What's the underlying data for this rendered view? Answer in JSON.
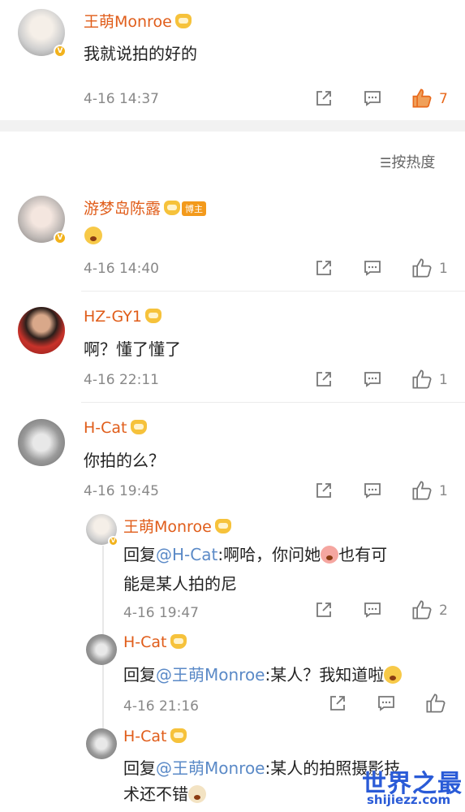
{
  "top_comment": {
    "user": "王萌Monroe",
    "text": "我就说拍的好的",
    "time": "4-16 14:37",
    "likes": "7"
  },
  "sort": {
    "label": "按热度",
    "icon": "sort-icon"
  },
  "comments": [
    {
      "user": "游梦岛陈露",
      "tag": "博主",
      "time": "4-16 14:40",
      "likes": "1"
    },
    {
      "user": "HZ-GY1",
      "text": "啊？懂了懂了",
      "time": "4-16 22:11",
      "likes": "1"
    },
    {
      "user": "H-Cat",
      "text": "你拍的么？",
      "time": "4-16 19:45",
      "likes": "1"
    }
  ],
  "replies": [
    {
      "user": "王萌Monroe",
      "prefix": "回复",
      "mention": "@H-Cat",
      "text1": ":啊哈，你问她",
      "text2": "也有可",
      "line2": "能是某人拍的尼",
      "time": "4-16 19:47",
      "likes": "2"
    },
    {
      "user": "H-Cat",
      "prefix": "回复",
      "mention": "@王萌Monroe",
      "text1": ":某人？我知道啦",
      "time": "4-16 21:16"
    },
    {
      "user": "H-Cat",
      "prefix": "回复",
      "mention": "@王萌Monroe",
      "text1": ":某人的拍照摄影技",
      "line2": "术还不错"
    }
  ],
  "watermark": {
    "title": "世界之最",
    "url": "shijiezz.com"
  },
  "colors": {
    "username": "#e05d1a",
    "mention": "#5b8ac7",
    "like_active": "#e8691c",
    "watermark": "#2a5bd7"
  }
}
